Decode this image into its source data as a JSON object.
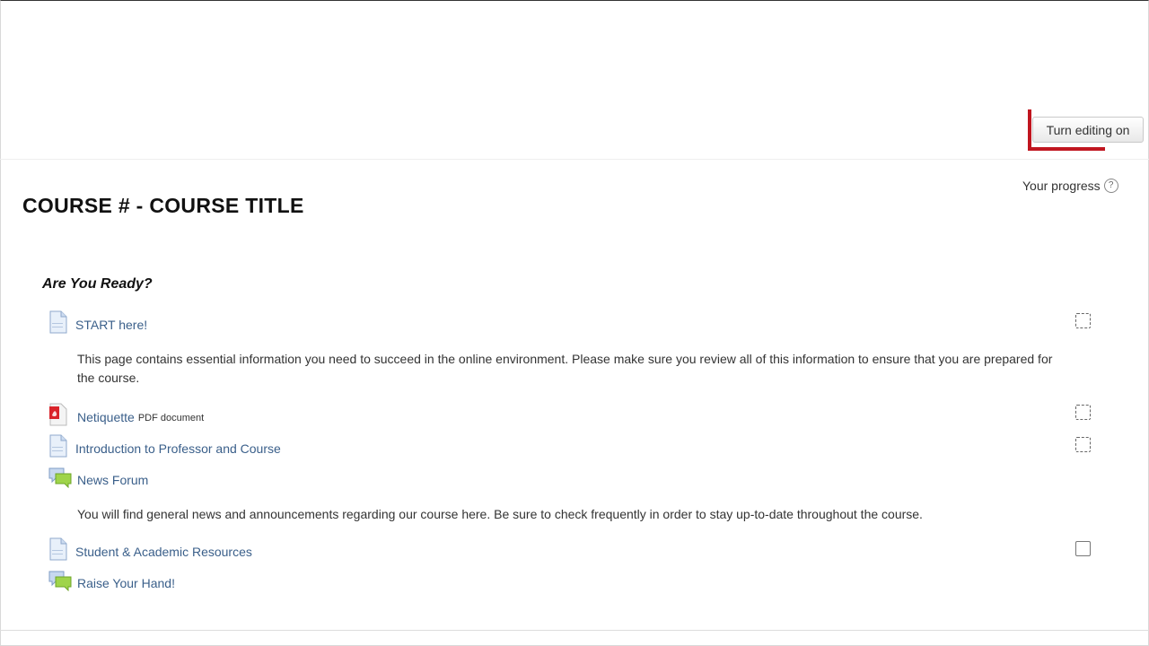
{
  "header": {
    "edit_button_label": "Turn editing on",
    "progress_label": "Your progress",
    "help_glyph": "?"
  },
  "course": {
    "title": "COURSE # - COURSE TITLE"
  },
  "section": {
    "title": "Are You Ready?",
    "activities": [
      {
        "name": "START here!",
        "icon": "page-icon",
        "completion": "manual"
      },
      {
        "description": "This page contains essential information you need to succeed in the online environment. Please make sure you review all of this information to ensure that you are prepared for the course."
      },
      {
        "name": "Netiquette",
        "type_label": "PDF document",
        "icon": "pdf-icon",
        "completion": "manual"
      },
      {
        "name": "Introduction to Professor and Course",
        "icon": "page-icon",
        "completion": "manual"
      },
      {
        "name": "News Forum",
        "icon": "forum-icon"
      },
      {
        "description": "You will find general news and announcements regarding our course here.  Be sure to check frequently in order to stay up-to-date throughout the course."
      },
      {
        "name": "Student & Academic Resources",
        "icon": "page-icon",
        "completion": "manual-solid"
      },
      {
        "name": "Raise Your Hand!",
        "icon": "forum-icon"
      }
    ]
  },
  "colors": {
    "link": "#3a5f8a",
    "marker": "#c0151f"
  }
}
